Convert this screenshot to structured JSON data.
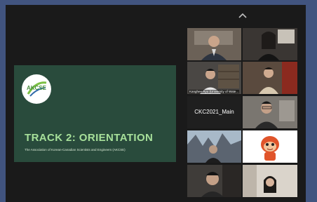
{
  "meeting": {
    "collapse_icon": "chevron-up-icon"
  },
  "shared_slide": {
    "logo_text": "AKCSE",
    "title": "TRACK 2: ORIENTATION",
    "subtitle": "The Association of Korean-Canadian Scientists and Engineers (AKCSE)",
    "background_color": "#294b3c",
    "title_color": "#a7e09a"
  },
  "participants": [
    {
      "name": "",
      "video": "man-in-suit"
    },
    {
      "name": "",
      "video": "woman-long-hair"
    },
    {
      "name": "Kanghee Ryu (University of Wate...",
      "video": "man-with-shelf",
      "speaking": true
    },
    {
      "name": "",
      "video": "man-bright-room"
    },
    {
      "name": "CKC2021_Main",
      "video": "off"
    },
    {
      "name": "",
      "video": "man-with-glasses"
    },
    {
      "name": "",
      "video": "mountain-background"
    },
    {
      "name": "",
      "video": "mascot-avatar"
    },
    {
      "name": "",
      "video": "man-dark-room"
    },
    {
      "name": "",
      "video": "woman-bottom"
    }
  ]
}
